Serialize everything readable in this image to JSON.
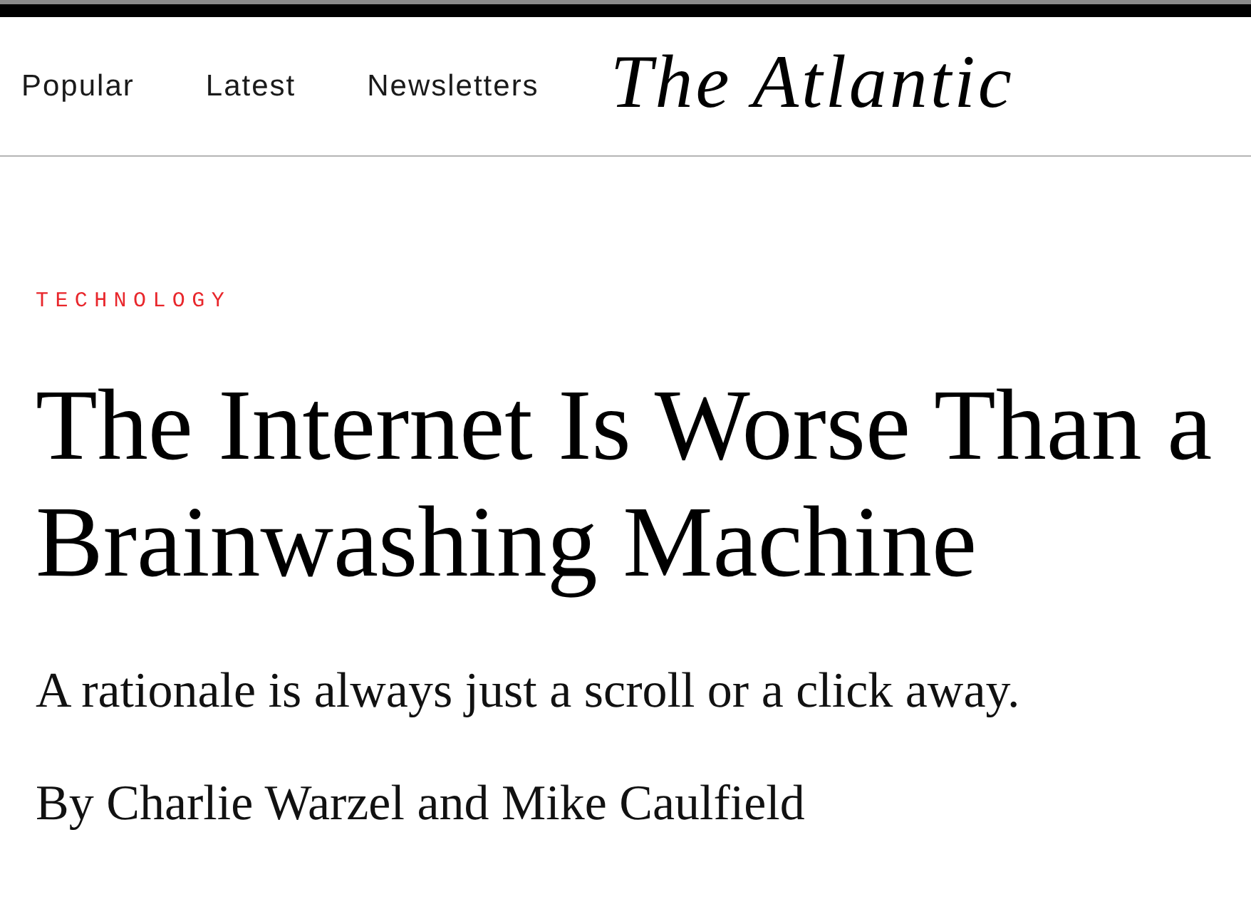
{
  "nav": {
    "links": [
      "Popular",
      "Latest",
      "Newsletters"
    ],
    "logo": "The Atlantic"
  },
  "article": {
    "category": "TECHNOLOGY",
    "headline": "The Internet Is Worse Than a Brainwashing Machine",
    "dek": "A rationale is always just a scroll or a click away.",
    "byline": "By Charlie Warzel and Mike Caulfield"
  }
}
